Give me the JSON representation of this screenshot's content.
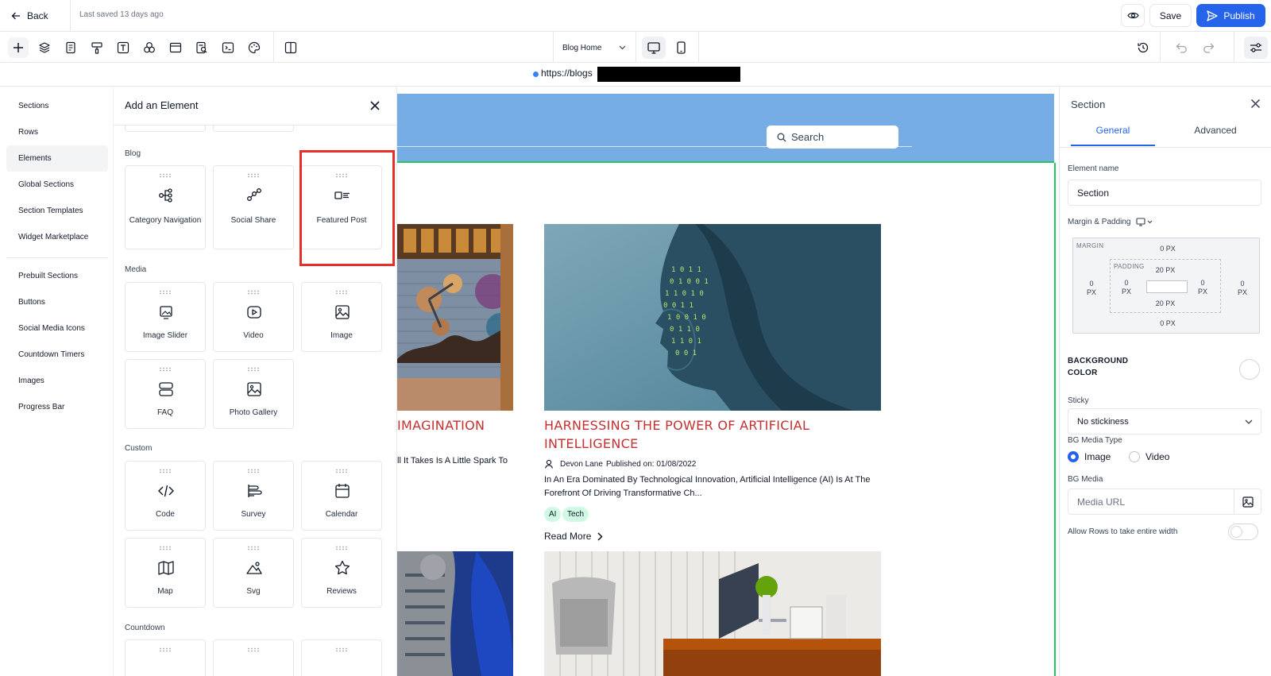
{
  "topbar": {
    "back_label": "Back",
    "last_saved": "Last saved 13 days ago",
    "save_label": "Save",
    "publish_label": "Publish"
  },
  "toolbar": {
    "page_select_value": "Blog Home",
    "tool_icons": [
      "plus-icon",
      "layers-icon",
      "pages-icon",
      "paint-roller-icon",
      "text-icon",
      "elements-icon",
      "layout-icon",
      "search-page-icon",
      "code-icon",
      "palette-icon",
      "split-view-icon"
    ]
  },
  "url": {
    "text": "https://blogs"
  },
  "category_rail": {
    "items": [
      "Sections",
      "Rows",
      "Elements",
      "Global Sections",
      "Section Templates",
      "Widget Marketplace",
      "Prebuilt Sections",
      "Buttons",
      "Social Media Icons",
      "Countdown Timers",
      "Images",
      "Progress Bar"
    ],
    "active": "Elements"
  },
  "add_panel": {
    "title": "Add an Element",
    "groups": {
      "blog": "Blog",
      "media": "Media",
      "custom": "Custom",
      "countdown": "Countdown"
    },
    "tiles": {
      "category_navigation": "Category Navigation",
      "social_share": "Social Share",
      "featured_post": "Featured Post",
      "image_slider": "Image Slider",
      "video": "Video",
      "image": "Image",
      "faq": "FAQ",
      "photo_gallery": "Photo Gallery",
      "code": "Code",
      "survey": "Survey",
      "calendar": "Calendar",
      "map": "Map",
      "svg": "Svg",
      "reviews": "Reviews"
    }
  },
  "canvas": {
    "search_label": "Search",
    "post1": {
      "title_fragment": "IMAGINATION",
      "excerpt_fragment": "ll It Takes Is A Little Spark To"
    },
    "post2": {
      "title": "HARNESSING THE POWER OF ARTIFICIAL INTELLIGENCE",
      "author": "Devon Lane",
      "published": "Published on: 01/08/2022",
      "excerpt": "In An Era Dominated By Technological Innovation, Artificial Intelligence (AI) Is At The Forefront Of Driving Transformative Ch...",
      "tags": [
        "AI",
        "Tech"
      ],
      "read_more": "Read More"
    }
  },
  "right_panel": {
    "title": "Section",
    "tabs": [
      "General",
      "Advanced"
    ],
    "element_name_label": "Element name",
    "element_name_value": "Section",
    "margin_padding_label": "Margin & Padding",
    "margin_caption": "MARGIN",
    "padding_caption": "PADDING",
    "margin": {
      "top": "0",
      "right": "0",
      "bottom": "0",
      "left": "0",
      "unit": "PX"
    },
    "padding": {
      "top": "20",
      "right": "0",
      "bottom": "20",
      "left": "0",
      "unit": "PX"
    },
    "bg_color_label_1": "BACKGROUND",
    "bg_color_label_2": "COLOR",
    "sticky_label": "Sticky",
    "sticky_value": "No stickiness",
    "bg_media_type_label": "BG Media Type",
    "bg_media_type_options": [
      "Image",
      "Video"
    ],
    "bg_media_type_selected": "Image",
    "bg_media_label": "BG Media",
    "bg_media_placeholder": "Media URL",
    "entire_width_label": "Allow Rows to take entire width",
    "entire_width_on": false
  },
  "colors": {
    "accent": "#2563eb",
    "header_bg": "#76ade4",
    "post_title": "#c53030",
    "highlight": "#e8302b",
    "tag_bg": "#d1fae5"
  }
}
